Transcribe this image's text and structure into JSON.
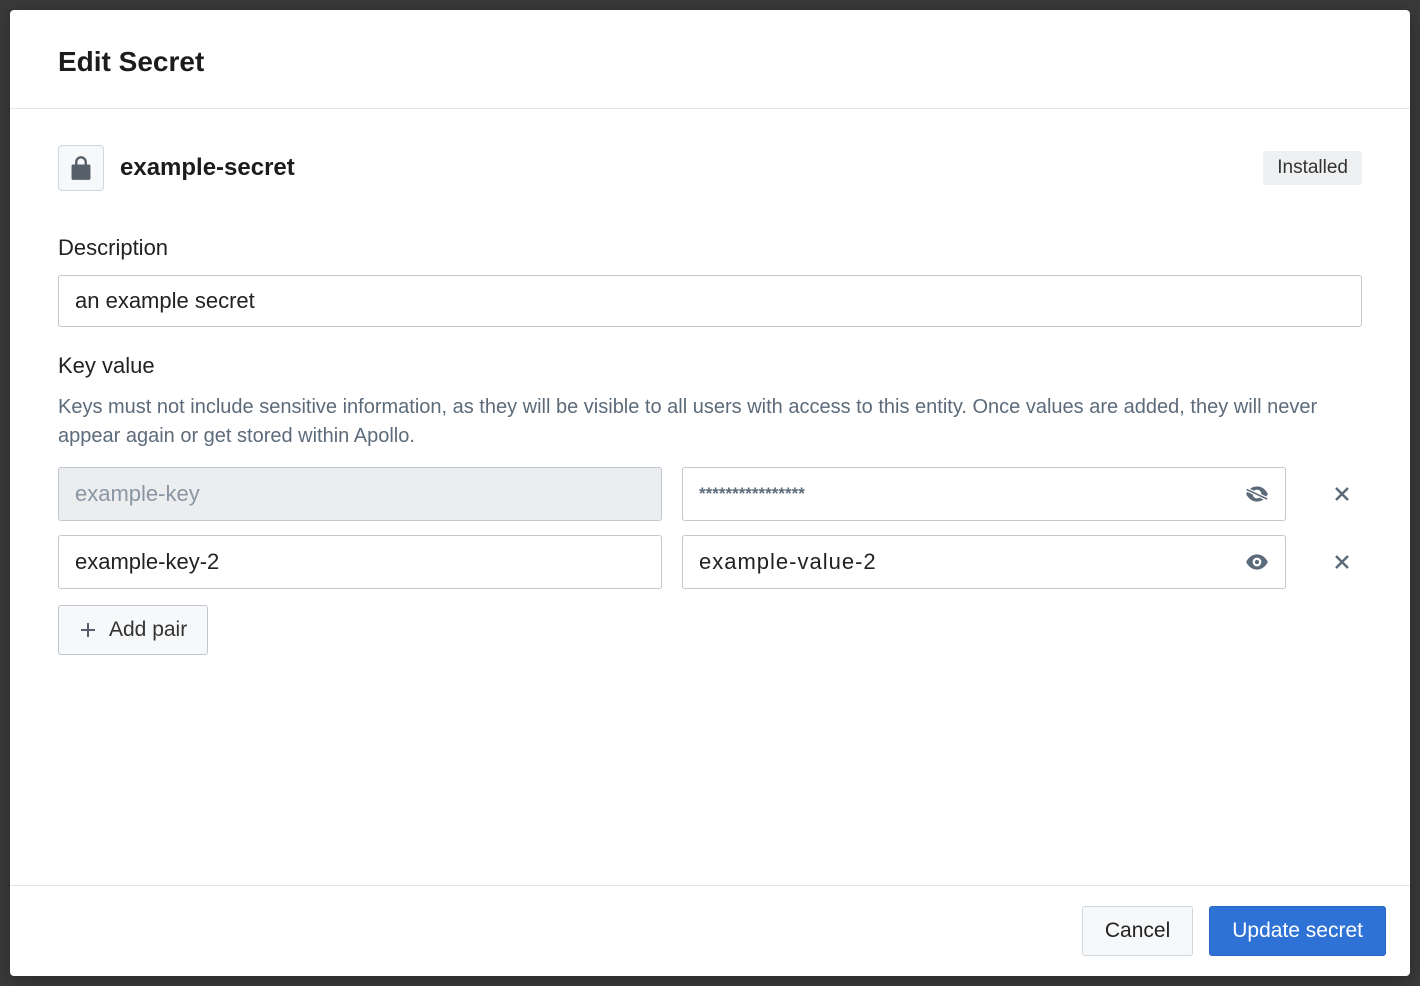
{
  "modal": {
    "title": "Edit Secret"
  },
  "secret": {
    "name": "example-secret",
    "status_badge": "Installed"
  },
  "description": {
    "label": "Description",
    "value": "an example secret"
  },
  "keyvalue": {
    "label": "Key value",
    "help": "Keys must not include sensitive information, as they will be visible to all users with access to this entity. Once values are added, they will never appear again or get stored within Apollo.",
    "rows": [
      {
        "key": "example-key",
        "value_display": "****************",
        "masked": true,
        "key_editable": false
      },
      {
        "key": "example-key-2",
        "value_display": "example-value-2",
        "masked": false,
        "key_editable": true
      }
    ],
    "add_pair_label": "Add pair"
  },
  "footer": {
    "cancel": "Cancel",
    "submit": "Update secret"
  }
}
